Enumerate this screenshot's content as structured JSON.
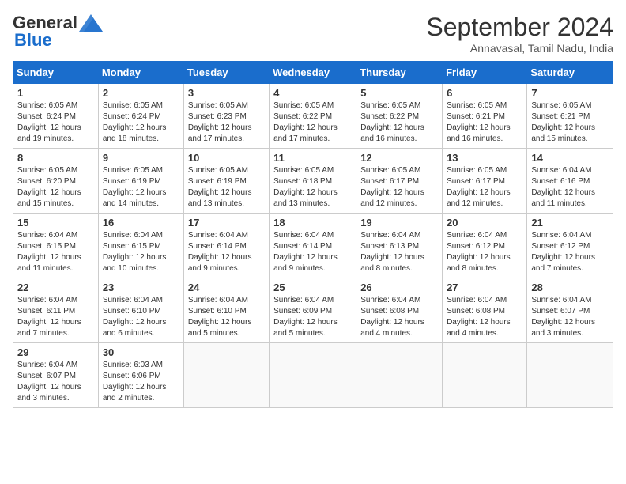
{
  "header": {
    "logo_line1": "General",
    "logo_line2": "Blue",
    "month": "September 2024",
    "location": "Annavasal, Tamil Nadu, India"
  },
  "weekdays": [
    "Sunday",
    "Monday",
    "Tuesday",
    "Wednesday",
    "Thursday",
    "Friday",
    "Saturday"
  ],
  "weeks": [
    [
      {
        "day": "1",
        "sunrise": "6:05 AM",
        "sunset": "6:24 PM",
        "daylight": "12 hours and 19 minutes."
      },
      {
        "day": "2",
        "sunrise": "6:05 AM",
        "sunset": "6:24 PM",
        "daylight": "12 hours and 18 minutes."
      },
      {
        "day": "3",
        "sunrise": "6:05 AM",
        "sunset": "6:23 PM",
        "daylight": "12 hours and 17 minutes."
      },
      {
        "day": "4",
        "sunrise": "6:05 AM",
        "sunset": "6:22 PM",
        "daylight": "12 hours and 17 minutes."
      },
      {
        "day": "5",
        "sunrise": "6:05 AM",
        "sunset": "6:22 PM",
        "daylight": "12 hours and 16 minutes."
      },
      {
        "day": "6",
        "sunrise": "6:05 AM",
        "sunset": "6:21 PM",
        "daylight": "12 hours and 16 minutes."
      },
      {
        "day": "7",
        "sunrise": "6:05 AM",
        "sunset": "6:21 PM",
        "daylight": "12 hours and 15 minutes."
      }
    ],
    [
      {
        "day": "8",
        "sunrise": "6:05 AM",
        "sunset": "6:20 PM",
        "daylight": "12 hours and 15 minutes."
      },
      {
        "day": "9",
        "sunrise": "6:05 AM",
        "sunset": "6:19 PM",
        "daylight": "12 hours and 14 minutes."
      },
      {
        "day": "10",
        "sunrise": "6:05 AM",
        "sunset": "6:19 PM",
        "daylight": "12 hours and 13 minutes."
      },
      {
        "day": "11",
        "sunrise": "6:05 AM",
        "sunset": "6:18 PM",
        "daylight": "12 hours and 13 minutes."
      },
      {
        "day": "12",
        "sunrise": "6:05 AM",
        "sunset": "6:17 PM",
        "daylight": "12 hours and 12 minutes."
      },
      {
        "day": "13",
        "sunrise": "6:05 AM",
        "sunset": "6:17 PM",
        "daylight": "12 hours and 12 minutes."
      },
      {
        "day": "14",
        "sunrise": "6:04 AM",
        "sunset": "6:16 PM",
        "daylight": "12 hours and 11 minutes."
      }
    ],
    [
      {
        "day": "15",
        "sunrise": "6:04 AM",
        "sunset": "6:15 PM",
        "daylight": "12 hours and 11 minutes."
      },
      {
        "day": "16",
        "sunrise": "6:04 AM",
        "sunset": "6:15 PM",
        "daylight": "12 hours and 10 minutes."
      },
      {
        "day": "17",
        "sunrise": "6:04 AM",
        "sunset": "6:14 PM",
        "daylight": "12 hours and 9 minutes."
      },
      {
        "day": "18",
        "sunrise": "6:04 AM",
        "sunset": "6:14 PM",
        "daylight": "12 hours and 9 minutes."
      },
      {
        "day": "19",
        "sunrise": "6:04 AM",
        "sunset": "6:13 PM",
        "daylight": "12 hours and 8 minutes."
      },
      {
        "day": "20",
        "sunrise": "6:04 AM",
        "sunset": "6:12 PM",
        "daylight": "12 hours and 8 minutes."
      },
      {
        "day": "21",
        "sunrise": "6:04 AM",
        "sunset": "6:12 PM",
        "daylight": "12 hours and 7 minutes."
      }
    ],
    [
      {
        "day": "22",
        "sunrise": "6:04 AM",
        "sunset": "6:11 PM",
        "daylight": "12 hours and 7 minutes."
      },
      {
        "day": "23",
        "sunrise": "6:04 AM",
        "sunset": "6:10 PM",
        "daylight": "12 hours and 6 minutes."
      },
      {
        "day": "24",
        "sunrise": "6:04 AM",
        "sunset": "6:10 PM",
        "daylight": "12 hours and 5 minutes."
      },
      {
        "day": "25",
        "sunrise": "6:04 AM",
        "sunset": "6:09 PM",
        "daylight": "12 hours and 5 minutes."
      },
      {
        "day": "26",
        "sunrise": "6:04 AM",
        "sunset": "6:08 PM",
        "daylight": "12 hours and 4 minutes."
      },
      {
        "day": "27",
        "sunrise": "6:04 AM",
        "sunset": "6:08 PM",
        "daylight": "12 hours and 4 minutes."
      },
      {
        "day": "28",
        "sunrise": "6:04 AM",
        "sunset": "6:07 PM",
        "daylight": "12 hours and 3 minutes."
      }
    ],
    [
      {
        "day": "29",
        "sunrise": "6:04 AM",
        "sunset": "6:07 PM",
        "daylight": "12 hours and 3 minutes."
      },
      {
        "day": "30",
        "sunrise": "6:03 AM",
        "sunset": "6:06 PM",
        "daylight": "12 hours and 2 minutes."
      },
      null,
      null,
      null,
      null,
      null
    ]
  ]
}
